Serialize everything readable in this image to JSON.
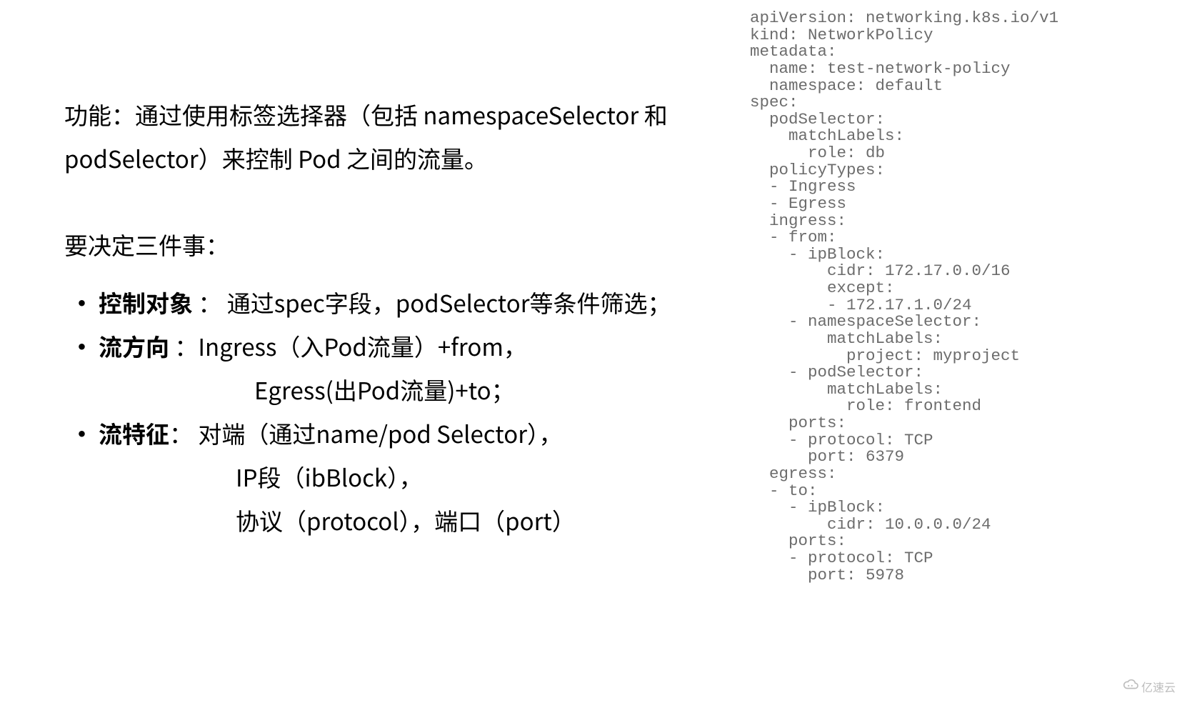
{
  "left": {
    "intro": "功能：通过使用标签选择器（包括 namespaceSelector 和 podSelector）来控制 Pod 之间的流量。",
    "decide_heading": "要决定三件事：",
    "bullets": [
      {
        "label": "控制对象",
        "text": " ： 通过spec字段，podSelector等条件筛选；",
        "continuations": []
      },
      {
        "label": "流方向",
        "text": "  ：Ingress（入Pod流量）+from，",
        "continuations": [
          "Egress(出Pod流量)+to；"
        ]
      },
      {
        "label": "流特征",
        "text": "： 对端（通过name/pod Selector），",
        "continuations": [
          "IP段（ibBlock），",
          "协议（protocol），端口（port）"
        ]
      }
    ]
  },
  "code": "apiVersion: networking.k8s.io/v1\nkind: NetworkPolicy\nmetadata:\n  name: test-network-policy\n  namespace: default\nspec:\n  podSelector:\n    matchLabels:\n      role: db\n  policyTypes:\n  - Ingress\n  - Egress\n  ingress:\n  - from:\n    - ipBlock:\n        cidr: 172.17.0.0/16\n        except:\n        - 172.17.1.0/24\n    - namespaceSelector:\n        matchLabels:\n          project: myproject\n    - podSelector:\n        matchLabels:\n          role: frontend\n    ports:\n    - protocol: TCP\n      port: 6379\n  egress:\n  - to:\n    - ipBlock:\n        cidr: 10.0.0.0/24\n    ports:\n    - protocol: TCP\n      port: 5978",
  "watermark": "亿速云"
}
